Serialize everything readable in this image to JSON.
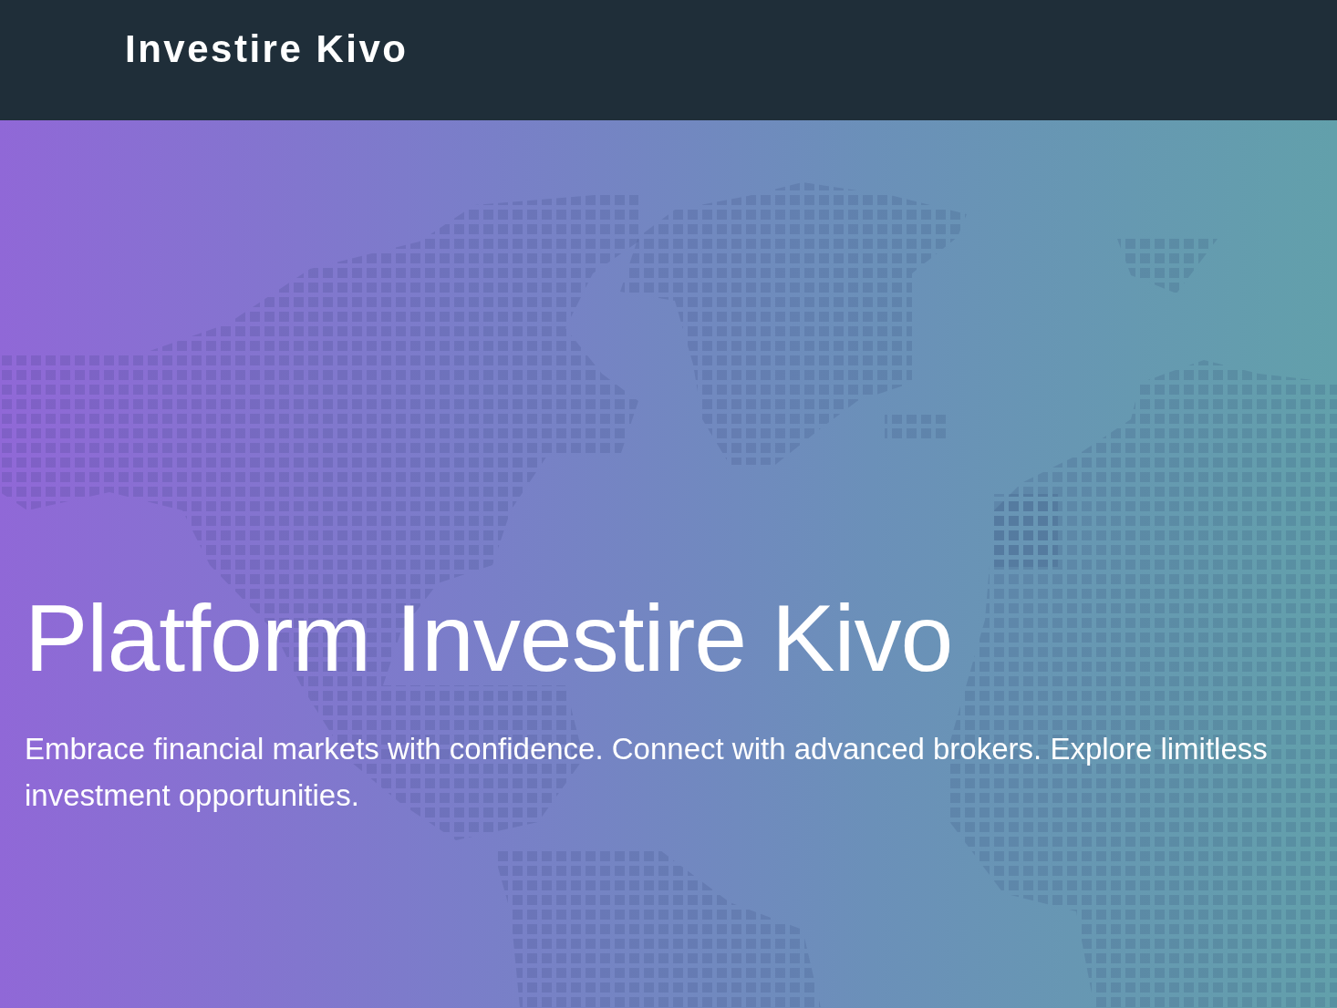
{
  "header": {
    "logo": "Investire Kivo"
  },
  "hero": {
    "title": "Platform Investire Kivo",
    "text": "Embrace financial markets with confidence. Connect with advanced brokers. Explore limitless investment opportunities."
  }
}
